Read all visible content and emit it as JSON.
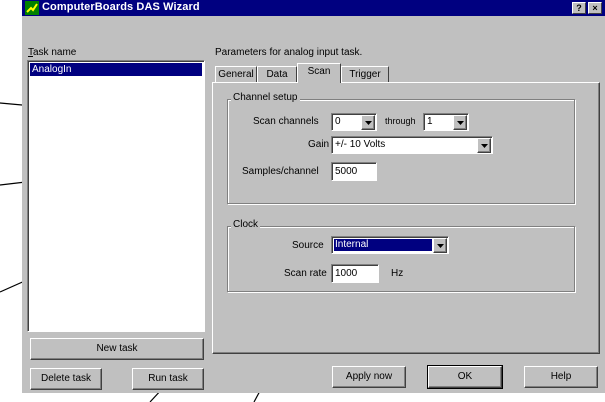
{
  "window": {
    "title": "ComputerBoards DAS Wizard",
    "help_btn": "?",
    "close_btn": "×"
  },
  "left": {
    "task_name_label": "Task name",
    "tasks": [
      "AnalogIn"
    ],
    "new_task_btn": "New task",
    "delete_task_btn": "Delete task",
    "run_task_btn": "Run task"
  },
  "right": {
    "params_label": "Parameters for analog input task.",
    "tabs": [
      "General",
      "Data",
      "Scan",
      "Trigger"
    ],
    "active_tab": "Scan",
    "channel_setup": {
      "legend": "Channel setup",
      "scan_channels_label": "Scan channels",
      "scan_from": "0",
      "through_label": "through",
      "scan_to": "1",
      "gain_label": "Gain",
      "gain_value": "+/- 10 Volts",
      "samples_label": "Samples/channel",
      "samples_value": "5000"
    },
    "clock": {
      "legend": "Clock",
      "source_label": "Source",
      "source_value": "Internal",
      "scan_rate_label": "Scan rate",
      "scan_rate_value": "1000",
      "scan_rate_unit": "Hz"
    }
  },
  "buttons": {
    "apply": "Apply now",
    "ok": "OK",
    "help": "Help"
  },
  "colors": {
    "titlebar": "#000080",
    "selection": "#000080",
    "face": "#c0c0c0"
  }
}
